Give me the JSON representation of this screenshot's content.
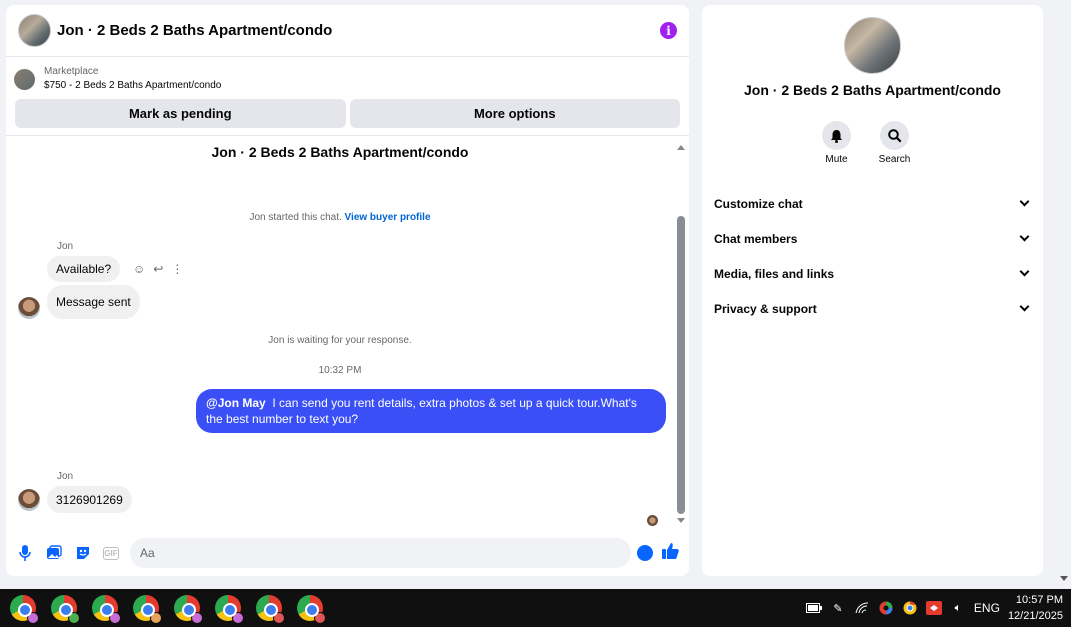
{
  "header": {
    "title": "Jon · 2 Beds 2 Baths Apartment/condo",
    "info_icon": "info-icon"
  },
  "listing": {
    "label": "Marketplace",
    "price_title": "$750 - 2 Beds 2 Baths Apartment/condo"
  },
  "actions": {
    "mark_pending": "Mark as pending",
    "more_options": "More options"
  },
  "thread": {
    "title": "Jon · 2 Beds 2 Baths Apartment/condo",
    "started_text": "Jon started this chat.",
    "view_profile": "View buyer profile",
    "sender_name": "Jon",
    "msg1": "Available?",
    "msg2": "Message sent",
    "waiting": "Jon is waiting for your response.",
    "timestamp": "10:32 PM",
    "out_mention": "@Jon May",
    "out_text": "I can send you rent details, extra photos & set up a quick tour.What's the best number to text you?",
    "sender_name2": "Jon",
    "msg3": "3126901269"
  },
  "composer": {
    "placeholder": "Aa",
    "gif": "GIF"
  },
  "side": {
    "title": "Jon · 2 Beds 2 Baths Apartment/condo",
    "mute": "Mute",
    "search": "Search",
    "menu": [
      "Customize chat",
      "Chat members",
      "Media, files and links",
      "Privacy & support"
    ]
  },
  "taskbar": {
    "lang": "ENG",
    "time": "10:57 PM",
    "date": "12/21/2025",
    "badge_colors": [
      "#c86dd7",
      "#4caf50",
      "#c86dd7",
      "#e8a45b",
      "#c86dd7",
      "#c86dd7",
      "#e05555",
      "#e05555"
    ]
  },
  "colors": {
    "accent": "#0866ff",
    "outgoing_bubble": "#3a4ff5",
    "info": "#a020f0"
  }
}
